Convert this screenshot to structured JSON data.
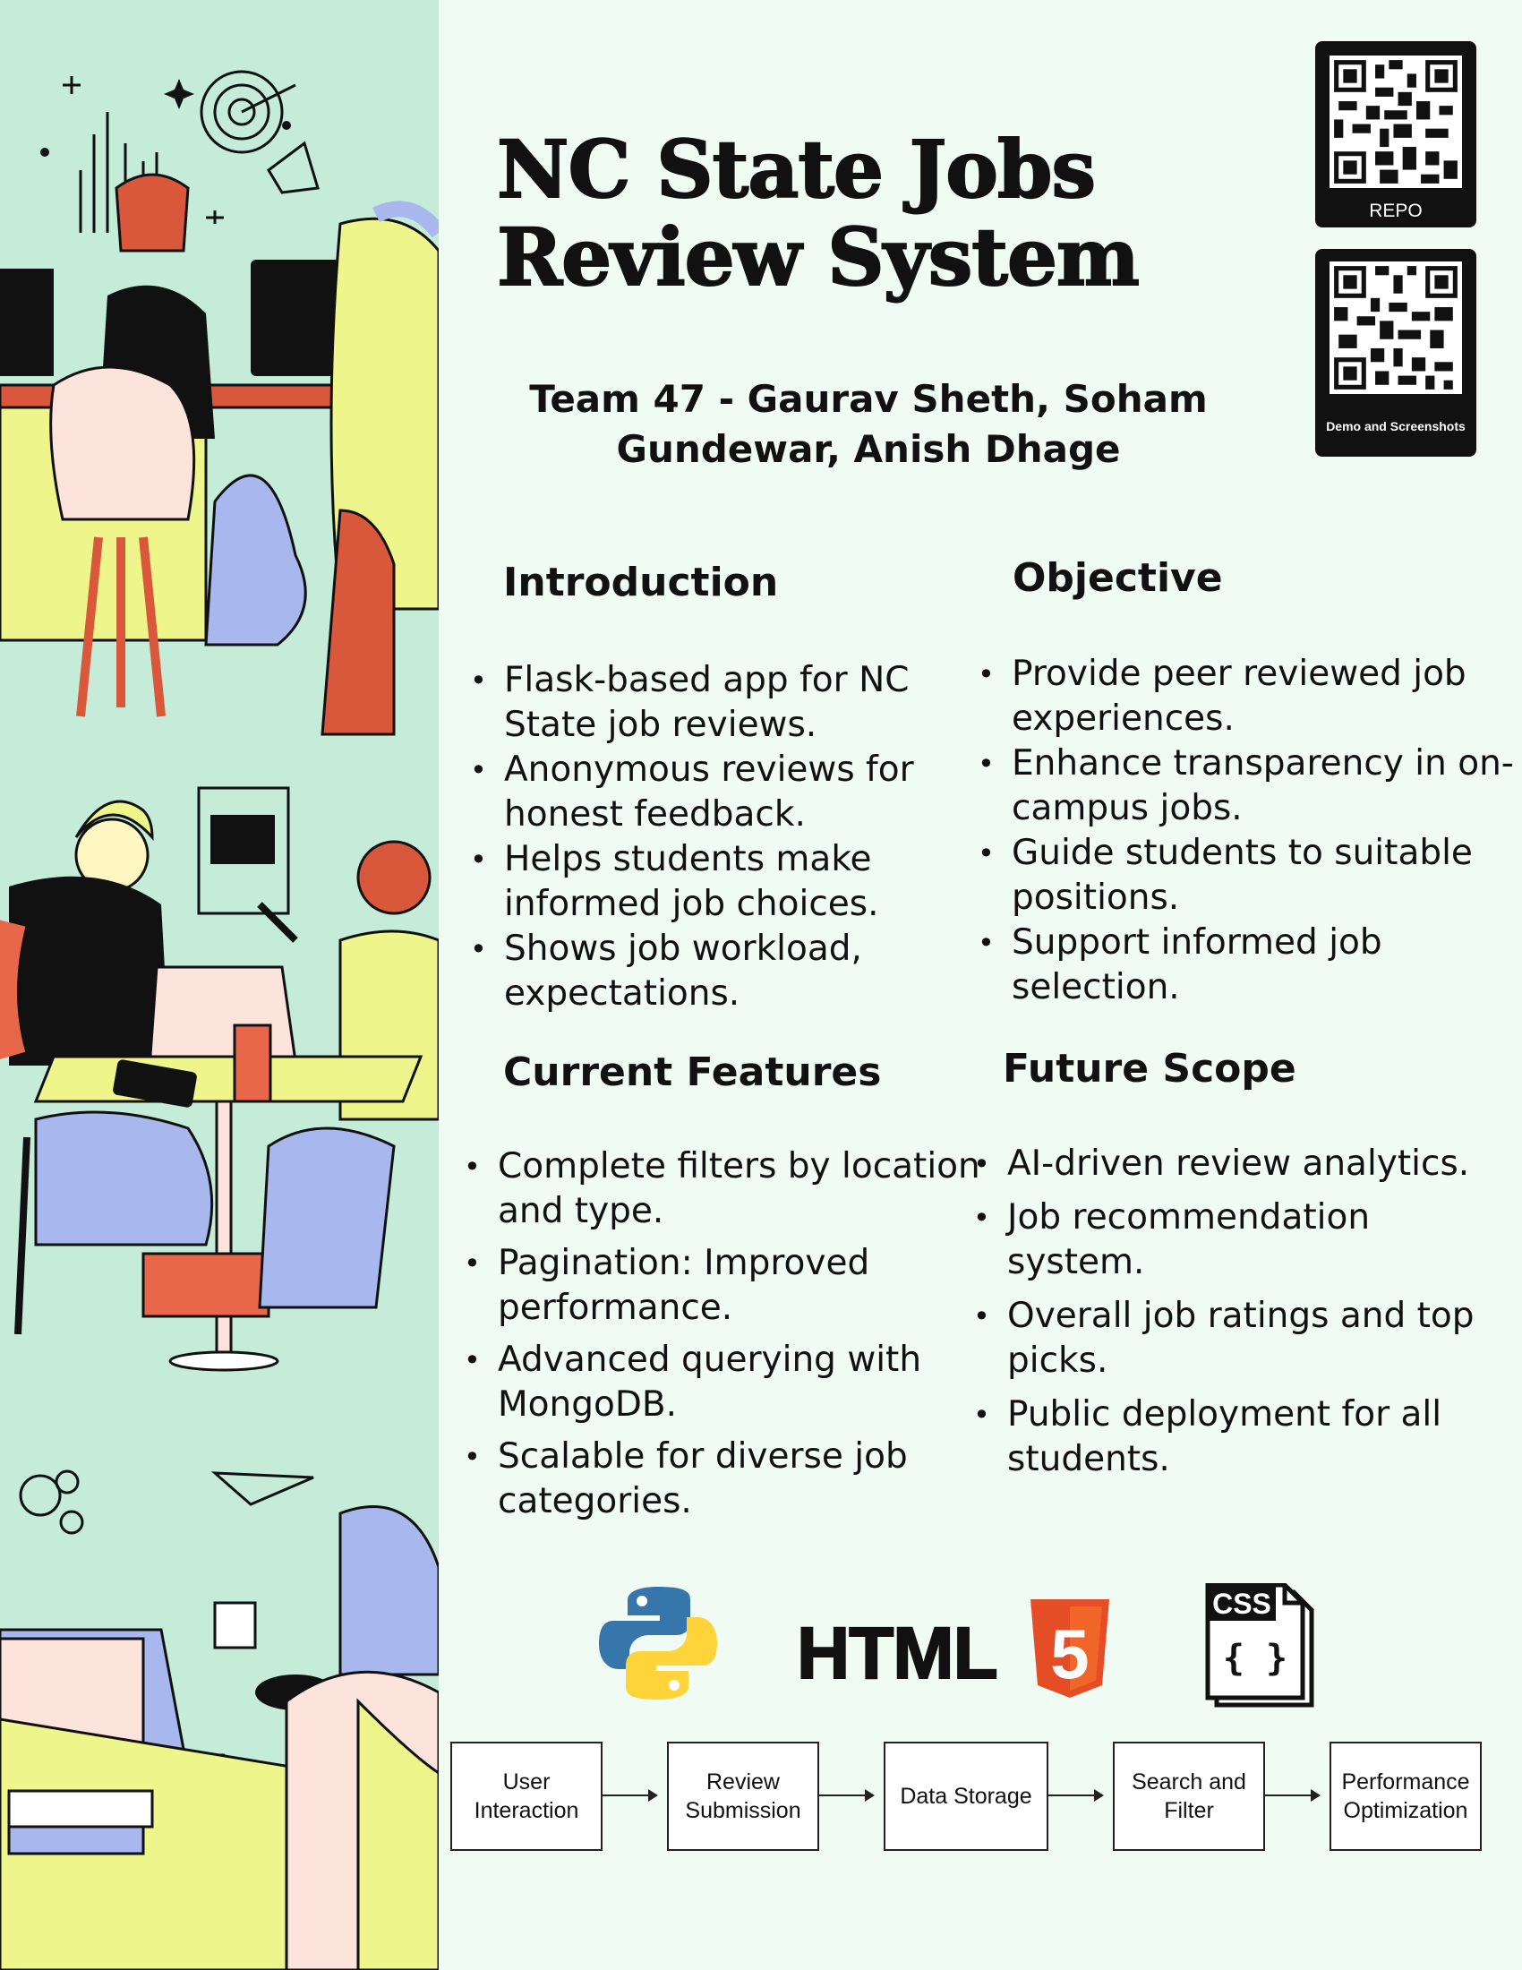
{
  "title_line1": "NC State Jobs",
  "title_line2": "Review System",
  "team": "Team 47 - Gaurav Sheth, Soham Gundewar, Anish Dhage",
  "qr_repo_caption": "REPO",
  "qr_demo_caption": "Demo and Screenshots",
  "introduction": {
    "heading": "Introduction",
    "items": [
      "Flask-based app for NC State job reviews.",
      "Anonymous reviews for honest feedback.",
      "Helps students make informed job choices.",
      "Shows job workload, expectations."
    ]
  },
  "objective": {
    "heading": "Objective",
    "items": [
      "Provide peer reviewed job experiences.",
      "Enhance transparency in on-campus jobs.",
      "Guide students to suitable positions.",
      "Support informed job selection."
    ]
  },
  "current_features": {
    "heading": "Current Features",
    "items": [
      "Complete filters by location and type.",
      "Pagination: Improved performance.",
      "Advanced querying with MongoDB.",
      "Scalable for diverse job categories."
    ]
  },
  "future_scope": {
    "heading": "Future Scope",
    "items": [
      "AI-driven review analytics.",
      "Job recommendation system.",
      "Overall job ratings and top picks.",
      "Public deployment for all students."
    ]
  },
  "logos": {
    "html_text": "HTML",
    "html_badge": "5",
    "css_text": "CSS",
    "css_braces": "{ }"
  },
  "flow": [
    "User Interaction",
    "Review Submission",
    "Data Storage",
    "Search and Filter",
    "Performance Optimization"
  ],
  "colors": {
    "sidebar": "#c4ecd8",
    "background": "#f0fbf4",
    "html5_orange": "#e44d26",
    "python_blue": "#3776ab",
    "python_yellow": "#ffd43b",
    "illustration_yellow": "#eef58a",
    "illustration_red": "#d9583b",
    "illustration_blue": "#a9b7ef"
  }
}
